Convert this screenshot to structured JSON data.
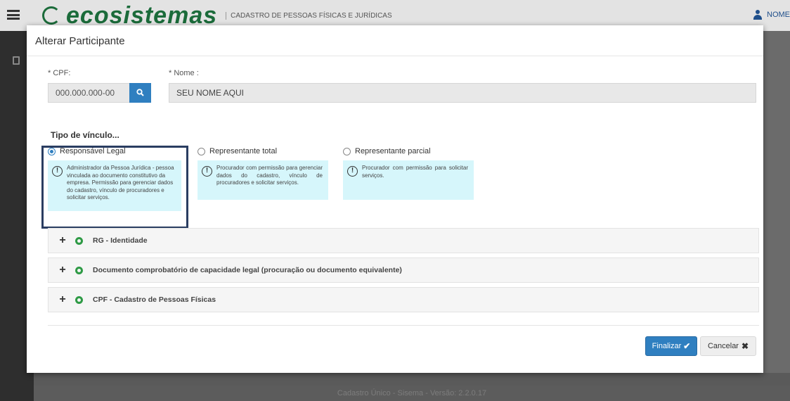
{
  "app": {
    "brand": "ecosistemas",
    "subtitle": "Cadastro de Pessoas Físicas e Jurídicas",
    "user": "NOME",
    "footer": "Cadastro Único - Sisema - Versão: 2.2.0.17"
  },
  "modal": {
    "title": "Alterar Participante",
    "cpf": {
      "label": "* CPF:",
      "value": "000.000.000-00"
    },
    "nome": {
      "label": "* Nome :",
      "value": "SEU NOME AQUI"
    },
    "vinculo_title": "Tipo de vínculo...",
    "options": [
      {
        "label": "Responsável Legal",
        "selected": true,
        "description": "Administrador da Pessoa Jurídica - pessoa vinculada ao documento constitutivo da empresa. Permissão para gerenciar dados do cadastro, vínculo de procuradores e solicitar serviços."
      },
      {
        "label": "Representante total",
        "selected": false,
        "description": "Procurador com permissão para gerenciar dados do cadastro, vínculo de procuradores e solicitar serviços."
      },
      {
        "label": "Representante parcial",
        "selected": false,
        "description": "Procurador com permissão para solicitar serviços."
      }
    ],
    "sections": [
      {
        "label": "RG - Identidade"
      },
      {
        "label": "Documento comprobatório de capacidade legal (procuração ou documento equivalente)"
      },
      {
        "label": "CPF - Cadastro de Pessoas Físicas"
      }
    ],
    "buttons": {
      "finalizar": "Finalizar",
      "cancelar": "Cancelar"
    }
  },
  "icons": {
    "menu": "hamburger-icon",
    "user": "user-icon",
    "search": "search-icon",
    "info": "info-icon",
    "expand": "plus-icon",
    "status": "check-circle-icon",
    "confirm": "checkmark-icon",
    "cancel": "close-icon"
  },
  "colors": {
    "primary": "#2f7fc0",
    "brand_green": "#1b6b3a",
    "info_bg": "#d6f6fb",
    "status_ok": "#2e9a45",
    "highlight_frame": "#2a3d61"
  }
}
